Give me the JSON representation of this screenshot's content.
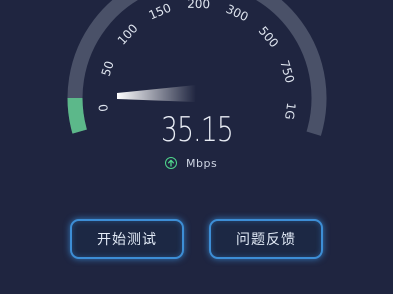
{
  "gauge": {
    "labels": [
      "0",
      "50",
      "100",
      "150",
      "200",
      "300",
      "500",
      "750",
      "1G"
    ],
    "progress_color": "#5cb88a",
    "track_color": "#4a5168"
  },
  "reading": {
    "value": "35.15",
    "unit": "Mbps",
    "unit_icon": "upload-arrow-icon",
    "unit_icon_color": "#4fd68c"
  },
  "actions": {
    "start_label": "开始测试",
    "feedback_label": "问题反馈"
  },
  "colors": {
    "background": "#1f2540",
    "button_glow": "#3d8ed6"
  }
}
